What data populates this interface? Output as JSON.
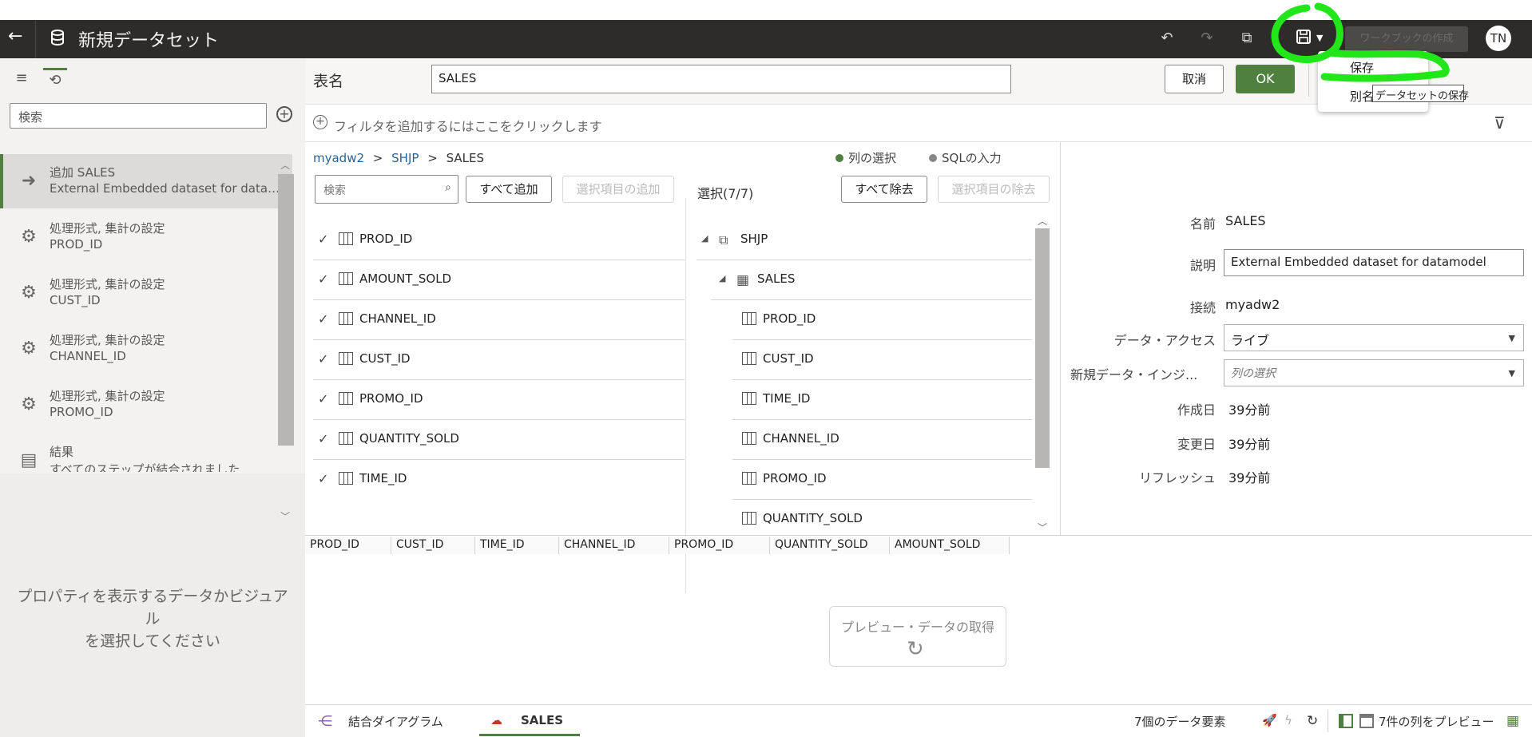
{
  "topbar": {
    "title": "新規データセット",
    "avatar": "TN",
    "create_label": "ワークブックの作成",
    "icons": [
      "back-arrow-icon",
      "database-icon",
      "undo-icon",
      "redo-icon",
      "dataset-preview-icon",
      "save-icon",
      "chevron-down-icon"
    ]
  },
  "save_menu": {
    "items": [
      "保存",
      "別名"
    ],
    "tooltip": "データセットの保存"
  },
  "left": {
    "search_placeholder": "検索",
    "steps": [
      {
        "line1": "追加 SALES",
        "line2": "External Embedded dataset for datamodel"
      },
      {
        "line1": "処理形式, 集計の設定",
        "line2": "PROD_ID"
      },
      {
        "line1": "処理形式, 集計の設定",
        "line2": "CUST_ID"
      },
      {
        "line1": "処理形式, 集計の設定",
        "line2": "CHANNEL_ID"
      },
      {
        "line1": "処理形式, 集計の設定",
        "line2": "PROMO_ID"
      },
      {
        "line1": "結果",
        "line2": "すべてのステップが結合されました"
      }
    ],
    "props_message_1": "プロパティを表示するデータかビジュアル",
    "props_message_2": "を選択してください"
  },
  "header": {
    "table_name_label": "表名",
    "table_name_value": "SALES",
    "cancel_label": "取消",
    "ok_label": "OK"
  },
  "filter": {
    "text": "フィルタを追加するにはここをクリックします"
  },
  "breadcrumb": {
    "connection": "myadw2",
    "schema": "SHJP",
    "table": "SALES",
    "sep": ">"
  },
  "mode": {
    "column_select": "列の選択",
    "sql_input": "SQLの入力",
    "active_color": "#50803f",
    "inactive_color": "#8a8886"
  },
  "available": {
    "search_placeholder": "検索",
    "add_all": "すべて追加",
    "add_selected": "選択項目の追加",
    "columns": [
      "PROD_ID",
      "AMOUNT_SOLD",
      "CHANNEL_ID",
      "CUST_ID",
      "PROMO_ID",
      "QUANTITY_SOLD",
      "TIME_ID"
    ]
  },
  "selected": {
    "count_label": "選択(7/7)",
    "remove_all": "すべて除去",
    "remove_selected": "選択項目の除去",
    "schema": "SHJP",
    "table": "SALES",
    "columns": [
      "PROD_ID",
      "CUST_ID",
      "TIME_ID",
      "CHANNEL_ID",
      "PROMO_ID",
      "QUANTITY_SOLD"
    ]
  },
  "properties": {
    "name_label": "名前",
    "name_value": "SALES",
    "desc_label": "説明",
    "desc_value": "External Embedded dataset for datamodel",
    "conn_label": "接続",
    "conn_value": "myadw2",
    "access_label": "データ・アクセス",
    "access_value": "ライブ",
    "new_data_label": "新規データ・インジ...",
    "new_data_placeholder": "列の選択",
    "created_label": "作成日",
    "created_value": "39分前",
    "modified_label": "変更日",
    "modified_value": "39分前",
    "refresh_label": "リフレッシュ",
    "refresh_value": "39分前"
  },
  "grid": {
    "headers": [
      "PROD_ID",
      "CUST_ID",
      "TIME_ID",
      "CHANNEL_ID",
      "PROMO_ID",
      "QUANTITY_SOLD",
      "AMOUNT_SOLD"
    ],
    "preview_label": "プレビュー・データの取得"
  },
  "bottom": {
    "tab_join": "結合ダイアグラム",
    "tab_sales": "SALES",
    "elements_count": "7個のデータ要素",
    "preview_cols": "7件の列をプレビュー"
  },
  "colors": {
    "accent": "#50803f",
    "topbar": "#2e2c2a",
    "annotation": "#22e61a"
  }
}
